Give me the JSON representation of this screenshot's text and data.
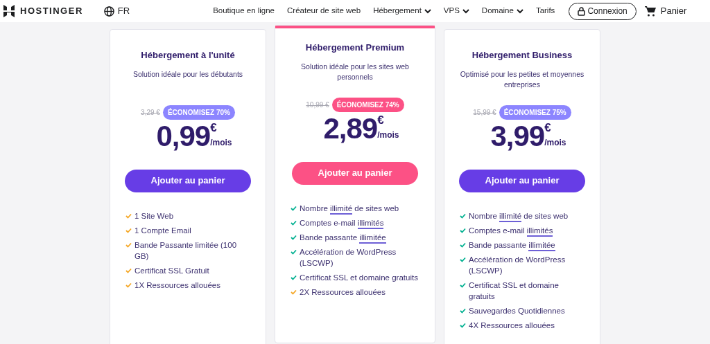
{
  "header": {
    "brand": "HOSTINGER",
    "language": "FR",
    "nav": [
      {
        "label": "Boutique en ligne",
        "dropdown": false
      },
      {
        "label": "Créateur de site web",
        "dropdown": false
      },
      {
        "label": "Hébergement",
        "dropdown": true
      },
      {
        "label": "VPS",
        "dropdown": true
      },
      {
        "label": "Domaine",
        "dropdown": true
      },
      {
        "label": "Tarifs",
        "dropdown": false
      }
    ],
    "login": "Connexion",
    "cart": "Panier"
  },
  "plans": [
    {
      "title": "Hébergement à l'unité",
      "subtitle": "Solution idéale pour les débutants",
      "featured": false,
      "old_price": "3,29 €",
      "discount": "ÉCONOMISEZ 70%",
      "price": "0,99",
      "currency": "€",
      "period": "/mois",
      "button": "Ajouter au panier",
      "features": [
        {
          "color": "#f5a623",
          "parts": [
            {
              "text": "1 Site Web",
              "underlined": false
            }
          ]
        },
        {
          "color": "#f5a623",
          "parts": [
            {
              "text": "1 Compte Email",
              "underlined": false
            }
          ]
        },
        {
          "color": "#f5a623",
          "parts": [
            {
              "text": "Bande Passante limitée (100 GB)",
              "underlined": false
            }
          ]
        },
        {
          "color": "#f5a623",
          "parts": [
            {
              "text": "Certificat SSL Gratuit",
              "underlined": false
            }
          ]
        },
        {
          "color": "#f5a623",
          "parts": [
            {
              "text": "1X Ressources allouées",
              "underlined": false
            }
          ]
        }
      ]
    },
    {
      "title": "Hébergement Premium",
      "subtitle": "Solution idéale pour les sites web personnels",
      "featured": true,
      "old_price": "10,99 €",
      "discount": "ÉCONOMISEZ 74%",
      "price": "2,89",
      "currency": "€",
      "period": "/mois",
      "button": "Ajouter au panier",
      "features": [
        {
          "color": "#00b090",
          "parts": [
            {
              "text": "Nombre ",
              "underlined": false
            },
            {
              "text": "illimité",
              "underlined": true
            },
            {
              "text": " de sites web",
              "underlined": false
            }
          ]
        },
        {
          "color": "#00b090",
          "parts": [
            {
              "text": "Comptes e-mail ",
              "underlined": false
            },
            {
              "text": "illimités",
              "underlined": true
            }
          ]
        },
        {
          "color": "#00b090",
          "parts": [
            {
              "text": "Bande passante ",
              "underlined": false
            },
            {
              "text": "illimitée",
              "underlined": true
            }
          ]
        },
        {
          "color": "#00b090",
          "parts": [
            {
              "text": "Accélération de WordPress (LSCWP)",
              "underlined": false
            }
          ]
        },
        {
          "color": "#00b090",
          "parts": [
            {
              "text": "Certificat SSL et domaine gratuits",
              "underlined": false
            }
          ]
        },
        {
          "color": "#f5a623",
          "parts": [
            {
              "text": "2X Ressources allouées",
              "underlined": false
            }
          ]
        }
      ]
    },
    {
      "title": "Hébergement Business",
      "subtitle": "Optimisé pour les petites et moyennes entreprises",
      "featured": false,
      "old_price": "15,99 €",
      "discount": "ÉCONOMISEZ 75%",
      "price": "3,99",
      "currency": "€",
      "period": "/mois",
      "button": "Ajouter au panier",
      "features": [
        {
          "color": "#00b090",
          "parts": [
            {
              "text": "Nombre ",
              "underlined": false
            },
            {
              "text": "illimité",
              "underlined": true
            },
            {
              "text": " de sites web",
              "underlined": false
            }
          ]
        },
        {
          "color": "#00b090",
          "parts": [
            {
              "text": "Comptes e-mail ",
              "underlined": false
            },
            {
              "text": "illimités",
              "underlined": true
            }
          ]
        },
        {
          "color": "#00b090",
          "parts": [
            {
              "text": "Bande passante ",
              "underlined": false
            },
            {
              "text": "illimitée",
              "underlined": true
            }
          ]
        },
        {
          "color": "#00b090",
          "parts": [
            {
              "text": "Accélération de WordPress (LSCWP)",
              "underlined": false
            }
          ]
        },
        {
          "color": "#00b090",
          "parts": [
            {
              "text": "Certificat SSL et domaine gratuits",
              "underlined": false
            }
          ]
        },
        {
          "color": "#00b090",
          "parts": [
            {
              "text": "Sauvegardes Quotidiennes",
              "underlined": false
            }
          ]
        },
        {
          "color": "#00b090",
          "parts": [
            {
              "text": "4X Ressources allouées",
              "underlined": false
            }
          ]
        }
      ]
    }
  ]
}
